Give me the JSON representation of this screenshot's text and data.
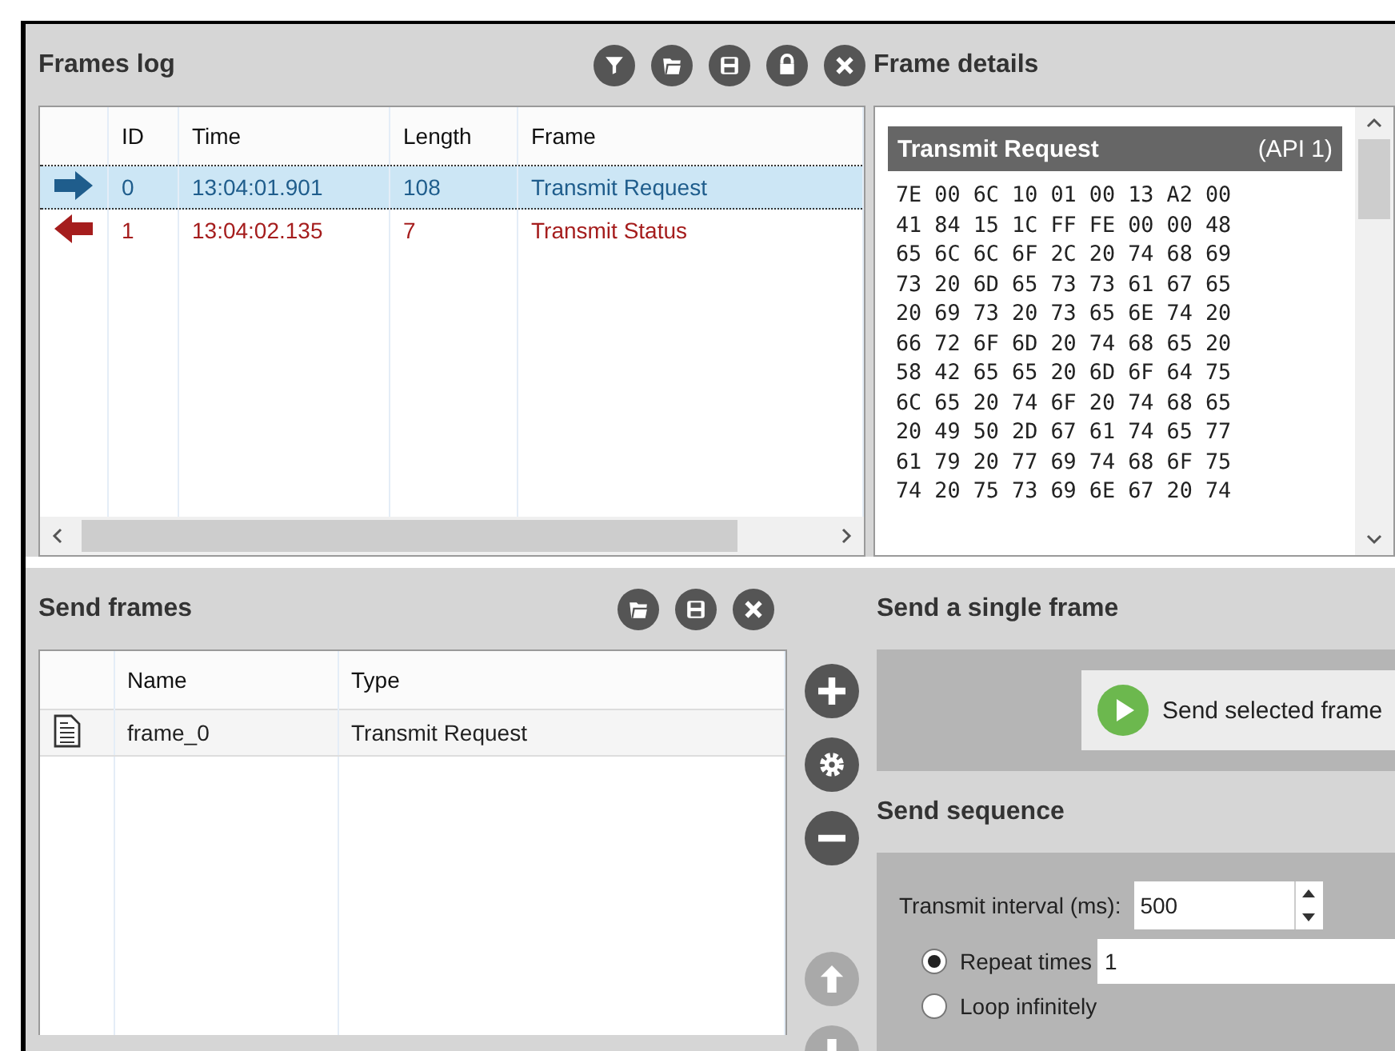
{
  "frames_log": {
    "title": "Frames log",
    "columns": [
      "ID",
      "Time",
      "Length",
      "Frame"
    ],
    "rows": [
      {
        "kind": "sent",
        "selected": true,
        "color": "#1f5d8c",
        "id": "0",
        "time": "13:04:01.901",
        "length": "108",
        "frame": "Transmit Request"
      },
      {
        "kind": "received",
        "selected": false,
        "color": "#a51d1d",
        "id": "1",
        "time": "13:04:02.135",
        "length": "7",
        "frame": "Transmit Status"
      }
    ]
  },
  "frame_details": {
    "title": "Frame details",
    "frame_type": "Transmit Request",
    "api": "(API 1)",
    "hex_lines": [
      "7E 00 6C 10 01 00 13 A2 00",
      "41 84 15 1C FF FE 00 00 48",
      "65 6C 6C 6F 2C 20 74 68 69",
      "73 20 6D 65 73 73 61 67 65",
      "20 69 73 20 73 65 6E 74 20",
      "66 72 6F 6D 20 74 68 65 20",
      "58 42 65 65 20 6D 6F 64 75",
      "6C 65 20 74 6F 20 74 68 65",
      "20 49 50 2D 67 61 74 65 77",
      "61 79 20 77 69 74 68 6F 75",
      "74 20 75 73 69 6E 67 20 74"
    ]
  },
  "send_frames": {
    "title": "Send frames",
    "columns": [
      "Name",
      "Type"
    ],
    "rows": [
      {
        "selected": true,
        "name": "frame_0",
        "type": "Transmit Request"
      }
    ],
    "side_buttons": [
      {
        "kind": "add",
        "disabled": false
      },
      {
        "kind": "settings",
        "disabled": false
      },
      {
        "kind": "remove",
        "disabled": false
      },
      {
        "kind": "up",
        "disabled": true
      },
      {
        "kind": "down",
        "disabled": true
      }
    ]
  },
  "send_single": {
    "title": "Send a single frame",
    "button": "Send selected frame"
  },
  "send_sequence": {
    "title": "Send sequence",
    "interval_label": "Transmit interval (ms):",
    "interval_value": "500",
    "options": [
      {
        "label": "Repeat times",
        "selected": true,
        "value": "1"
      },
      {
        "label": "Loop infinitely",
        "selected": false
      }
    ]
  }
}
